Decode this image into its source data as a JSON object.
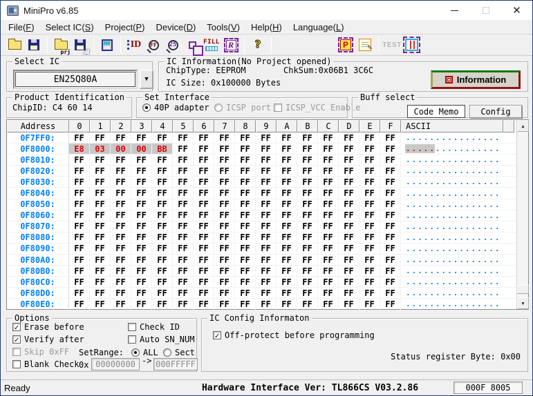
{
  "window": {
    "title": "MiniPro v6.85"
  },
  "menu": {
    "items": [
      {
        "name": "file",
        "pre": "File(",
        "key": "F",
        "post": ")"
      },
      {
        "name": "select-ic",
        "pre": "Select IC(",
        "key": "S",
        "post": ")"
      },
      {
        "name": "project",
        "pre": "Project(",
        "key": "P",
        "post": ")"
      },
      {
        "name": "device",
        "pre": "Device(",
        "key": "D",
        "post": ")"
      },
      {
        "name": "tools",
        "pre": "Tools(",
        "key": "V",
        "post": ")"
      },
      {
        "name": "help",
        "pre": "Help(",
        "key": "H",
        "post": ")"
      },
      {
        "name": "language",
        "pre": "Language(",
        "key": "L",
        "post": ")"
      }
    ]
  },
  "toolbar": {
    "prj_label": "prj",
    "id_label": "ID",
    "ff_label": "FF",
    "num25_label": "25",
    "fill_label": "FILL",
    "r_label": "R",
    "help_label": "?",
    "p_label": "P",
    "test_label": "TEST",
    "pencil": "✎"
  },
  "select_ic": {
    "group_label": "Select IC",
    "value": "EN25Q80A"
  },
  "ic_information": {
    "group_label": "IC Information(No Project opened)",
    "chip_type": "ChipType: EEPROM",
    "chksum": "ChkSum:0x06B1 3C6C",
    "ic_size": "IC Size:  0x100000 Bytes",
    "information_button": "Information"
  },
  "product_identification": {
    "group_label": "Product Identification",
    "chip_id": "ChipID: C4 60 14"
  },
  "set_interface": {
    "group_label": "Set Interface",
    "radio_40p": "40P adapter",
    "radio_icsp": "ICSP port",
    "checkbox_icsp_vcc": "ICSP_VCC Enable"
  },
  "buff_select": {
    "group_label": "Buff select",
    "tab_code": "Code Memo",
    "tab_config": "Config"
  },
  "grid": {
    "headers": [
      "Address",
      "0",
      "1",
      "2",
      "3",
      "4",
      "5",
      "6",
      "7",
      "8",
      "9",
      "A",
      "B",
      "C",
      "D",
      "E",
      "F",
      "ASCII"
    ],
    "rows": [
      {
        "address": "0F7FF0:",
        "modified": 0,
        "bytes": [
          "FF",
          "FF",
          "FF",
          "FF",
          "FF",
          "FF",
          "FF",
          "FF",
          "FF",
          "FF",
          "FF",
          "FF",
          "FF",
          "FF",
          "FF",
          "FF"
        ]
      },
      {
        "address": "0F8000:",
        "modified": 5,
        "bytes": [
          "E8",
          "03",
          "00",
          "00",
          "BB",
          "FF",
          "FF",
          "FF",
          "FF",
          "FF",
          "FF",
          "FF",
          "FF",
          "FF",
          "FF",
          "FF"
        ]
      },
      {
        "address": "0F8010:",
        "modified": 0,
        "bytes": [
          "FF",
          "FF",
          "FF",
          "FF",
          "FF",
          "FF",
          "FF",
          "FF",
          "FF",
          "FF",
          "FF",
          "FF",
          "FF",
          "FF",
          "FF",
          "FF"
        ]
      },
      {
        "address": "0F8020:",
        "modified": 0,
        "bytes": [
          "FF",
          "FF",
          "FF",
          "FF",
          "FF",
          "FF",
          "FF",
          "FF",
          "FF",
          "FF",
          "FF",
          "FF",
          "FF",
          "FF",
          "FF",
          "FF"
        ]
      },
      {
        "address": "0F8030:",
        "modified": 0,
        "bytes": [
          "FF",
          "FF",
          "FF",
          "FF",
          "FF",
          "FF",
          "FF",
          "FF",
          "FF",
          "FF",
          "FF",
          "FF",
          "FF",
          "FF",
          "FF",
          "FF"
        ]
      },
      {
        "address": "0F8040:",
        "modified": 0,
        "bytes": [
          "FF",
          "FF",
          "FF",
          "FF",
          "FF",
          "FF",
          "FF",
          "FF",
          "FF",
          "FF",
          "FF",
          "FF",
          "FF",
          "FF",
          "FF",
          "FF"
        ]
      },
      {
        "address": "0F8050:",
        "modified": 0,
        "bytes": [
          "FF",
          "FF",
          "FF",
          "FF",
          "FF",
          "FF",
          "FF",
          "FF",
          "FF",
          "FF",
          "FF",
          "FF",
          "FF",
          "FF",
          "FF",
          "FF"
        ]
      },
      {
        "address": "0F8060:",
        "modified": 0,
        "bytes": [
          "FF",
          "FF",
          "FF",
          "FF",
          "FF",
          "FF",
          "FF",
          "FF",
          "FF",
          "FF",
          "FF",
          "FF",
          "FF",
          "FF",
          "FF",
          "FF"
        ]
      },
      {
        "address": "0F8070:",
        "modified": 0,
        "bytes": [
          "FF",
          "FF",
          "FF",
          "FF",
          "FF",
          "FF",
          "FF",
          "FF",
          "FF",
          "FF",
          "FF",
          "FF",
          "FF",
          "FF",
          "FF",
          "FF"
        ]
      },
      {
        "address": "0F8080:",
        "modified": 0,
        "bytes": [
          "FF",
          "FF",
          "FF",
          "FF",
          "FF",
          "FF",
          "FF",
          "FF",
          "FF",
          "FF",
          "FF",
          "FF",
          "FF",
          "FF",
          "FF",
          "FF"
        ]
      },
      {
        "address": "0F8090:",
        "modified": 0,
        "bytes": [
          "FF",
          "FF",
          "FF",
          "FF",
          "FF",
          "FF",
          "FF",
          "FF",
          "FF",
          "FF",
          "FF",
          "FF",
          "FF",
          "FF",
          "FF",
          "FF"
        ]
      },
      {
        "address": "0F80A0:",
        "modified": 0,
        "bytes": [
          "FF",
          "FF",
          "FF",
          "FF",
          "FF",
          "FF",
          "FF",
          "FF",
          "FF",
          "FF",
          "FF",
          "FF",
          "FF",
          "FF",
          "FF",
          "FF"
        ]
      },
      {
        "address": "0F80B0:",
        "modified": 0,
        "bytes": [
          "FF",
          "FF",
          "FF",
          "FF",
          "FF",
          "FF",
          "FF",
          "FF",
          "FF",
          "FF",
          "FF",
          "FF",
          "FF",
          "FF",
          "FF",
          "FF"
        ]
      },
      {
        "address": "0F80C0:",
        "modified": 0,
        "bytes": [
          "FF",
          "FF",
          "FF",
          "FF",
          "FF",
          "FF",
          "FF",
          "FF",
          "FF",
          "FF",
          "FF",
          "FF",
          "FF",
          "FF",
          "FF",
          "FF"
        ]
      },
      {
        "address": "0F80D0:",
        "modified": 0,
        "bytes": [
          "FF",
          "FF",
          "FF",
          "FF",
          "FF",
          "FF",
          "FF",
          "FF",
          "FF",
          "FF",
          "FF",
          "FF",
          "FF",
          "FF",
          "FF",
          "FF"
        ]
      },
      {
        "address": "0F80E0:",
        "modified": 0,
        "bytes": [
          "FF",
          "FF",
          "FF",
          "FF",
          "FF",
          "FF",
          "FF",
          "FF",
          "FF",
          "FF",
          "FF",
          "FF",
          "FF",
          "FF",
          "FF",
          "FF"
        ]
      }
    ],
    "colors": {
      "address_blue": "#0080FF",
      "modified_red": "#DD0000",
      "highlight_gray": "#C8C8C8"
    }
  },
  "options": {
    "group_label": "Options",
    "erase_before": "Erase before",
    "verify_after": "Verify after",
    "skip_0xff": "Skip 0xFF",
    "blank_check": "Blank Check",
    "check_id": "Check ID",
    "auto_sn_num": "Auto SN_NUM",
    "set_range_label": "SetRange:",
    "radio_all": "ALL",
    "radio_sect": "Sect",
    "range_prefix": "0x",
    "range_from": "00000000",
    "range_arrow": "->",
    "range_to": "000FFFFF"
  },
  "ic_config": {
    "group_label": "IC Config Informaton",
    "off_protect": "Off-protect before programming",
    "status_register": "Status register Byte: 0x00"
  },
  "status_bar": {
    "ready": "Ready",
    "hardware": "Hardware Interface Ver: TL866CS V03.2.86",
    "address_box": "000F 8005"
  }
}
